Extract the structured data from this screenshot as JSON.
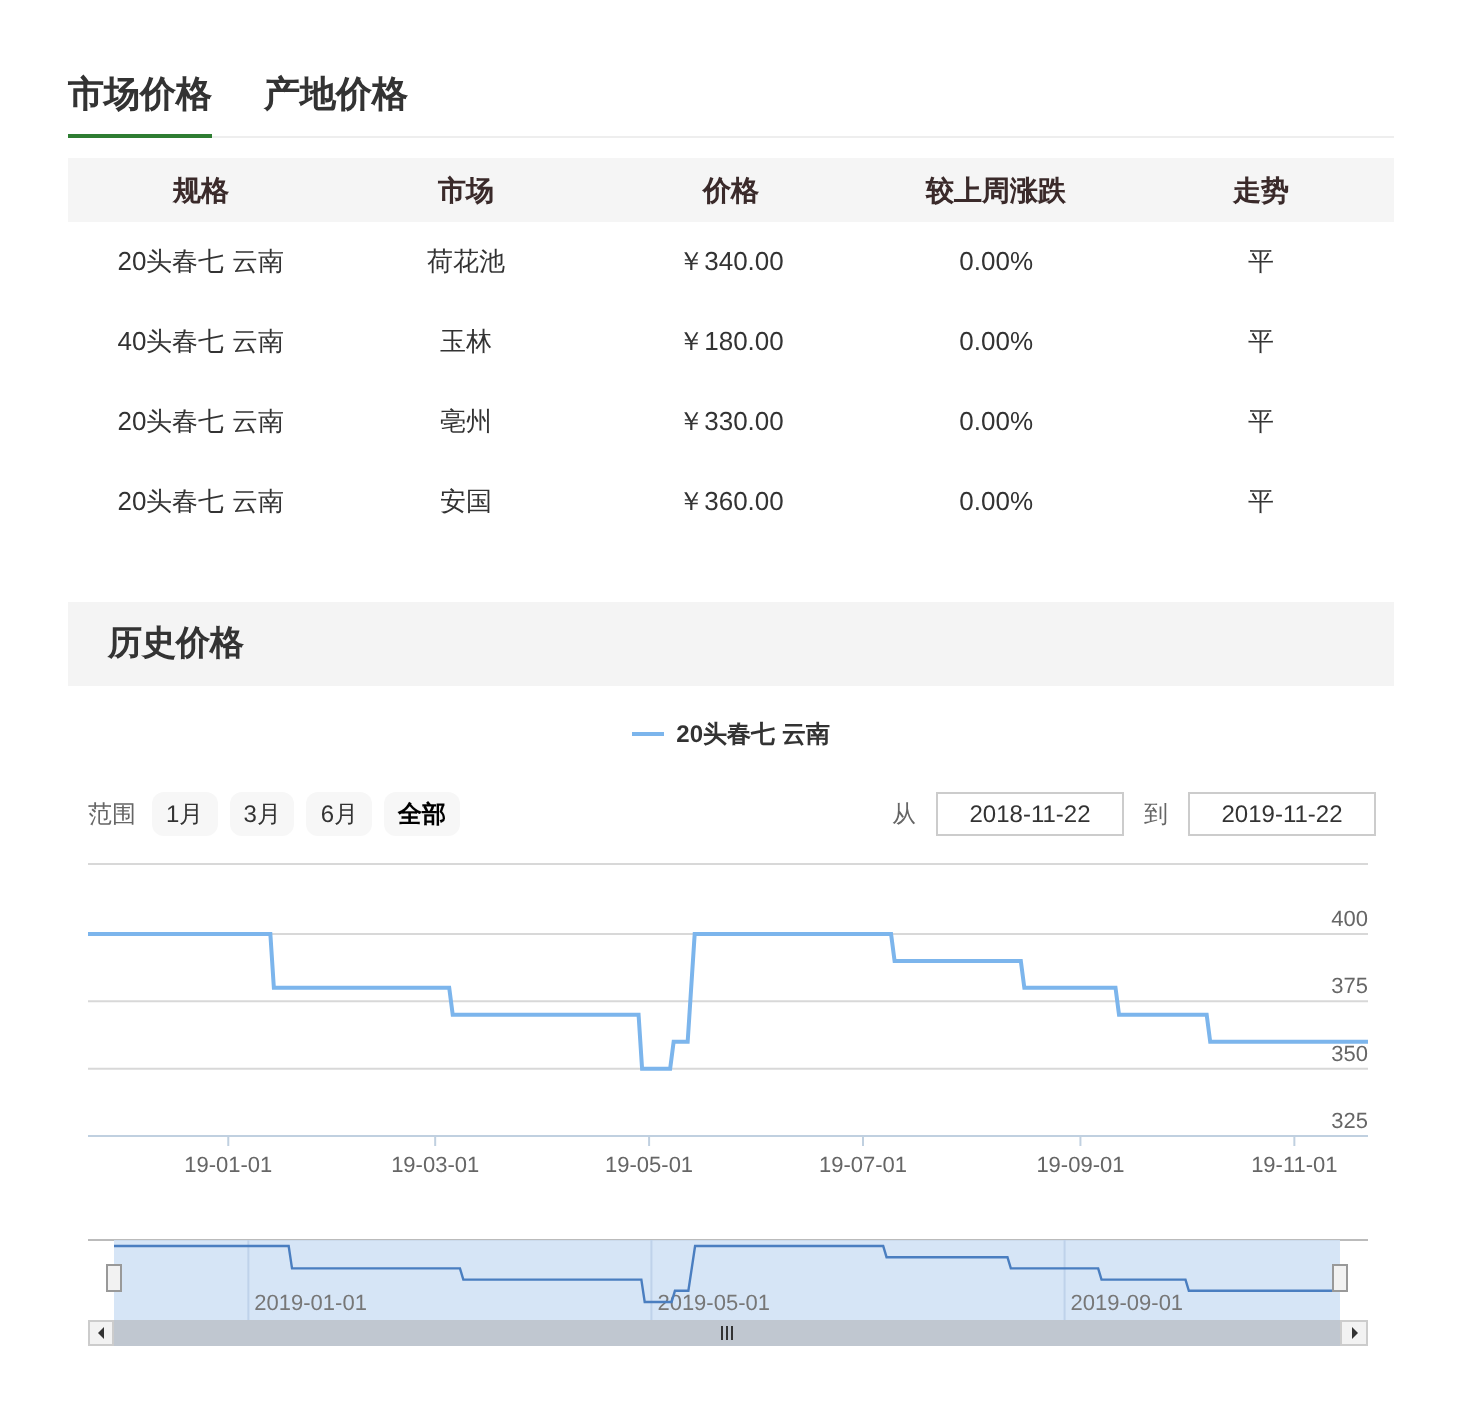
{
  "tabs": [
    {
      "label": "市场价格",
      "selected": true
    },
    {
      "label": "产地价格",
      "selected": false
    }
  ],
  "table": {
    "columns": [
      "规格",
      "市场",
      "价格",
      "较上周涨跌",
      "走势"
    ],
    "rows": [
      [
        "20头春七 云南",
        "荷花池",
        "￥340.00",
        "0.00%",
        "平"
      ],
      [
        "40头春七 云南",
        "玉林",
        "￥180.00",
        "0.00%",
        "平"
      ],
      [
        "20头春七 云南",
        "亳州",
        "￥330.00",
        "0.00%",
        "平"
      ],
      [
        "20头春七 云南",
        "安国",
        "￥360.00",
        "0.00%",
        "平"
      ]
    ]
  },
  "history": {
    "title": "历史价格",
    "range": {
      "label": "范围",
      "buttons": [
        {
          "label": "1月",
          "selected": false
        },
        {
          "label": "3月",
          "selected": false
        },
        {
          "label": "6月",
          "selected": false
        },
        {
          "label": "全部",
          "selected": true
        }
      ]
    },
    "from": {
      "label": "从",
      "value": "2018-11-22"
    },
    "to": {
      "label": "到",
      "value": "2019-11-22"
    },
    "chart_data": {
      "type": "line",
      "x": [
        "2018-11-22",
        "2019-01-13",
        "2019-01-14",
        "2019-03-05",
        "2019-03-06",
        "2019-04-28",
        "2019-04-29",
        "2019-05-07",
        "2019-05-08",
        "2019-05-12",
        "2019-05-14",
        "2019-07-09",
        "2019-07-10",
        "2019-08-15",
        "2019-08-16",
        "2019-09-11",
        "2019-09-12",
        "2019-10-07",
        "2019-10-08",
        "2019-11-22"
      ],
      "series": [
        {
          "name": "20头春七 云南",
          "color": "#7cb5ec",
          "values": [
            400,
            400,
            380,
            380,
            370,
            370,
            350,
            350,
            360,
            360,
            400,
            400,
            390,
            390,
            380,
            380,
            370,
            370,
            360,
            360
          ]
        }
      ],
      "xlim": [
        "2018-11-22",
        "2019-11-22"
      ],
      "ylim": [
        325,
        400
      ],
      "yticks": [
        325,
        350,
        375,
        400
      ],
      "xticks": [
        {
          "value": "2019-01-01",
          "label": "19-01-01"
        },
        {
          "value": "2019-03-01",
          "label": "19-03-01"
        },
        {
          "value": "2019-05-01",
          "label": "19-05-01"
        },
        {
          "value": "2019-07-01",
          "label": "19-07-01"
        },
        {
          "value": "2019-09-01",
          "label": "19-09-01"
        },
        {
          "value": "2019-11-01",
          "label": "19-11-01"
        }
      ]
    },
    "navigator": {
      "labels": [
        "2019-01-01",
        "2019-05-01",
        "2019-09-01"
      ]
    }
  }
}
